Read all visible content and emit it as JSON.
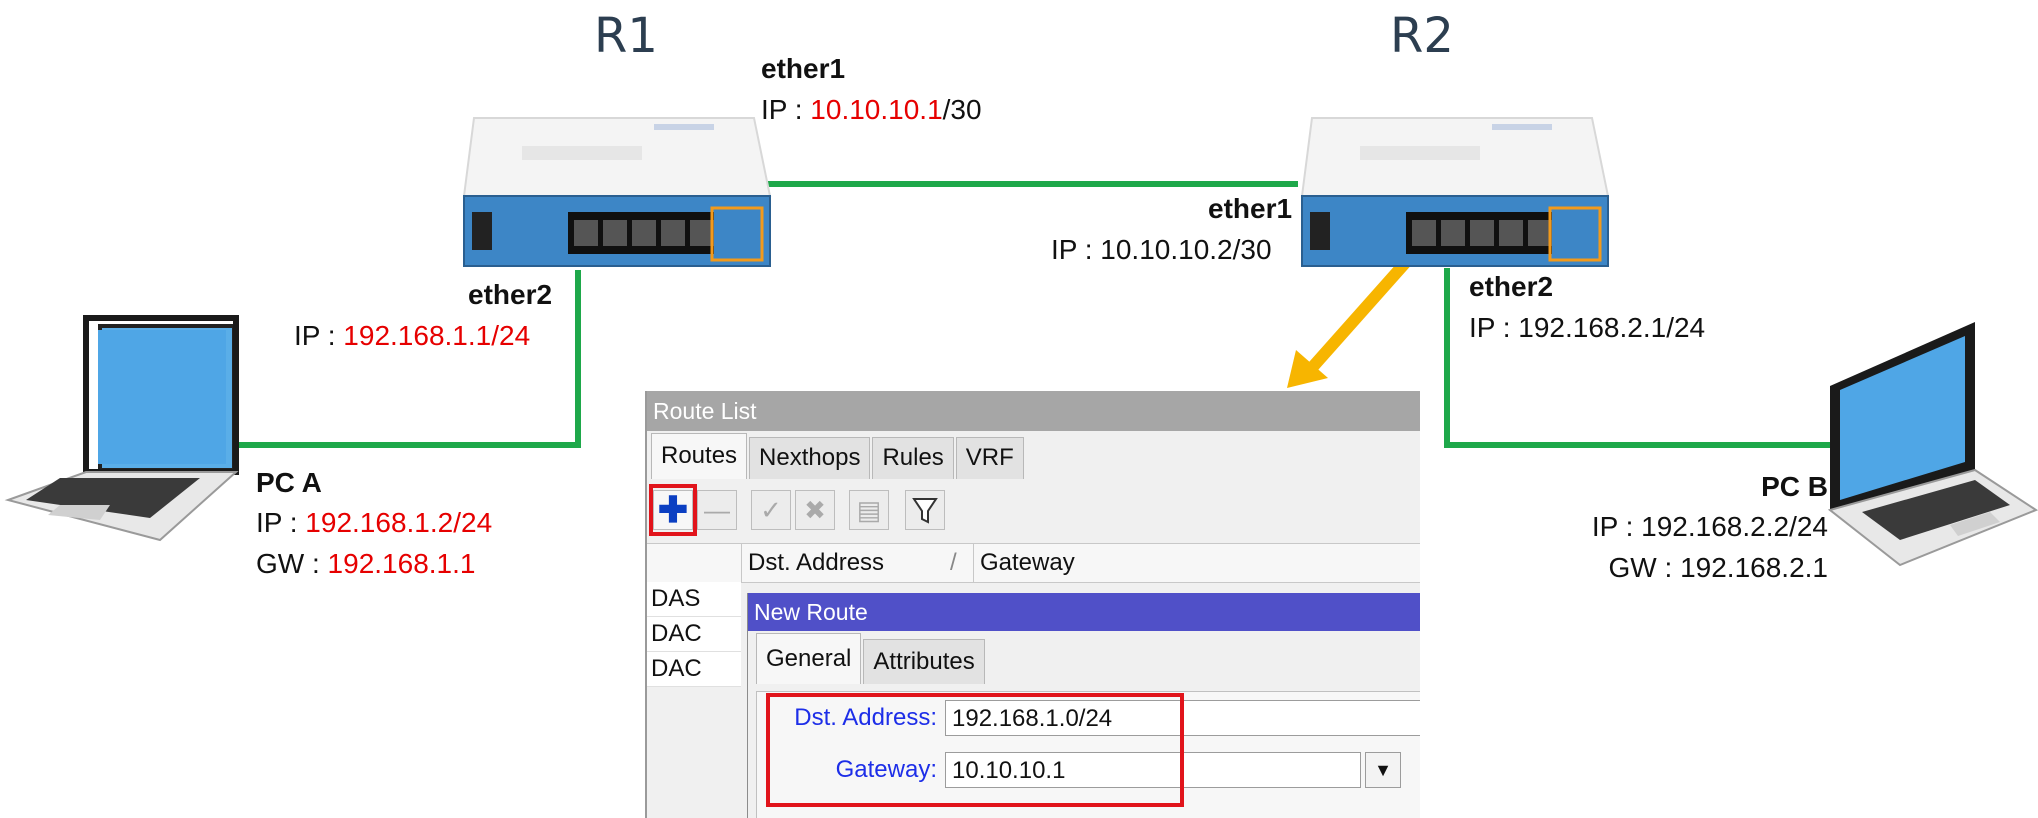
{
  "routers": {
    "r1": {
      "name": "R1"
    },
    "r2": {
      "name": "R2"
    }
  },
  "r1_ether1": {
    "iface": "ether1",
    "prefix": "IP : ",
    "ip": "10.10.10.1",
    "mask": "/30"
  },
  "r1_ether2": {
    "iface": "ether2",
    "prefix": "IP : ",
    "ip": "192.168.1.1/24"
  },
  "r2_ether1": {
    "iface": "ether1",
    "text": "IP : 10.10.10.2/30"
  },
  "r2_ether2": {
    "iface": "ether2",
    "text": "IP : 192.168.2.1/24"
  },
  "pc_a": {
    "name": "PC A",
    "ip_prefix": "IP : ",
    "ip": "192.168.1.2/24",
    "gw_prefix": "GW : ",
    "gw": "192.168.1.1"
  },
  "pc_b": {
    "name": "PC B",
    "ip_text": "IP : 192.168.2.2/24",
    "gw_text": "GW : 192.168.2.1"
  },
  "route_list": {
    "title": "Route List",
    "tabs": [
      "Routes",
      "Nexthops",
      "Rules",
      "VRF"
    ],
    "columns": {
      "dst": "Dst. Address",
      "sort": "/",
      "gateway": "Gateway"
    },
    "rows": [
      "DAS",
      "DAC",
      "DAC"
    ]
  },
  "new_route": {
    "title": "New Route",
    "tabs": [
      "General",
      "Attributes"
    ],
    "dst_label": "Dst. Address:",
    "dst_value": "192.168.1.0/24",
    "gw_label": "Gateway:",
    "gw_value": "10.10.10.1"
  },
  "colors": {
    "link": "#1ea84a",
    "highlight": "#e1141b",
    "arrow": "#f7b500",
    "red_text": "#e60000"
  }
}
